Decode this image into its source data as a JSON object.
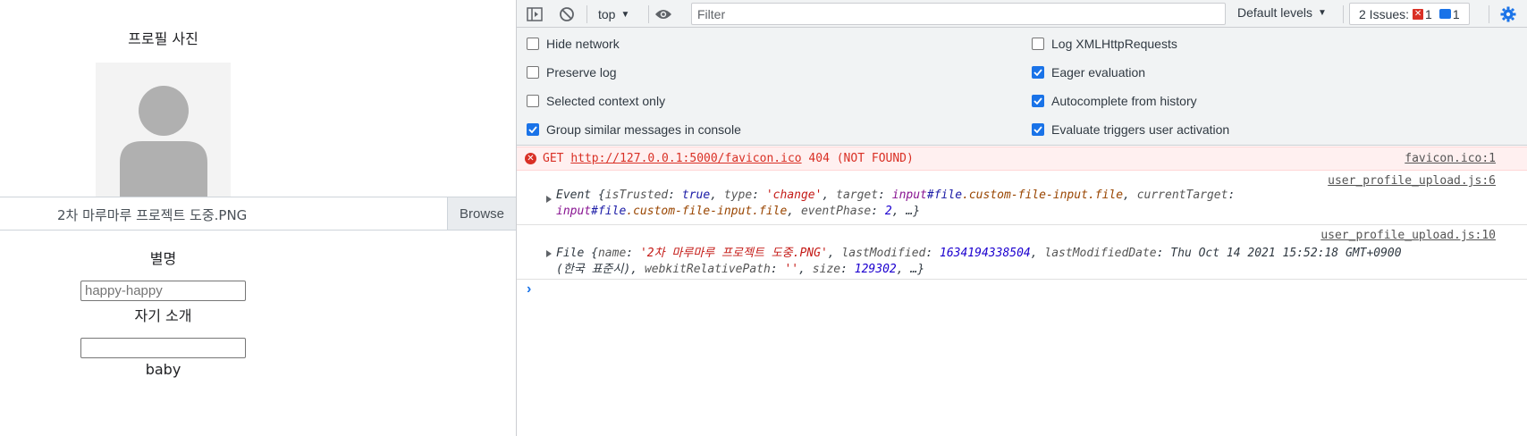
{
  "page": {
    "profile_title": "프로필 사진",
    "file_name": "2차 마루마루 프로젝트 도중.PNG",
    "browse_label": "Browse",
    "nickname_label": "별명",
    "nickname_placeholder": "happy-happy",
    "intro_label": "자기 소개",
    "intro_value": "",
    "baby_text": "baby"
  },
  "devtools": {
    "toolbar": {
      "context": "top",
      "filter_placeholder": "Filter",
      "levels": "Default levels",
      "issues_label": "2 Issues:",
      "issues_error_count": "1",
      "issues_info_count": "1"
    },
    "settings": {
      "left": [
        {
          "label": "Hide network",
          "checked": false
        },
        {
          "label": "Preserve log",
          "checked": false
        },
        {
          "label": "Selected context only",
          "checked": false
        },
        {
          "label": "Group similar messages in console",
          "checked": true
        }
      ],
      "right": [
        {
          "label": "Log XMLHttpRequests",
          "checked": false
        },
        {
          "label": "Eager evaluation",
          "checked": true
        },
        {
          "label": "Autocomplete from history",
          "checked": true
        },
        {
          "label": "Evaluate triggers user activation",
          "checked": true
        }
      ]
    },
    "console": {
      "error": {
        "method": "GET",
        "url": "http://127.0.0.1:5000/favicon.ico",
        "status": "404 (NOT FOUND)",
        "source": "favicon.ico:1"
      },
      "event_log": {
        "source": "user_profile_upload.js:6",
        "line1_prefix": "Event {",
        "k_isTrusted": "isTrusted",
        "v_isTrusted": "true",
        "k_type": "type",
        "v_type": "'change'",
        "k_target": "target",
        "v_target_tag": "input",
        "v_target_id": "#file",
        "v_target_cls": ".custom-file-input.file",
        "k_currentTarget": "currentTarget",
        "v_ct_tag": "input",
        "v_ct_id": "#file",
        "v_ct_cls": ".custom-file-input.file",
        "k_eventPhase": "eventPhase",
        "v_eventPhase": "2",
        "tail": ", …}"
      },
      "file_log": {
        "source": "user_profile_upload.js:10",
        "prefix": "File {",
        "k_name": "name",
        "v_name": "'2차 마루마루 프로젝트 도중.PNG'",
        "k_lastModified": "lastModified",
        "v_lastModified": "1634194338504",
        "k_lastModifiedDate": "lastModifiedDate",
        "v_lastModifiedDate_a": "Thu Oct 14 2021 15:52:18 GMT+0900",
        "v_lastModifiedDate_b": "(한국 표준시)",
        "k_webkitRelativePath": "webkitRelativePath",
        "v_webkitRelativePath": "''",
        "k_size": "size",
        "v_size": "129302",
        "tail": ", …}"
      },
      "prompt": "›"
    }
  }
}
